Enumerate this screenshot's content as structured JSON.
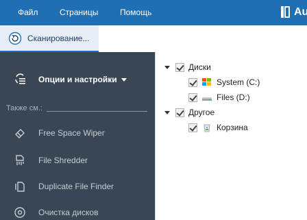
{
  "menubar": {
    "items": [
      "Файл",
      "Страницы",
      "Помощь"
    ],
    "brand_text": "Au",
    "background": "#1f6fb4"
  },
  "toolbar": {
    "scan_label": "Сканирование..."
  },
  "sidebar": {
    "options_label": "Опции и настройки",
    "also_label": "Также см.:",
    "tools": [
      {
        "label": "Free Space Wiper",
        "icon": "eraser-icon"
      },
      {
        "label": "File Shredder",
        "icon": "shredder-icon"
      },
      {
        "label": "Duplicate File Finder",
        "icon": "duplicate-icon"
      },
      {
        "label": "Очистка дисков",
        "icon": "disk-icon"
      }
    ]
  },
  "tree": {
    "disks_label": "Диски",
    "drives": [
      {
        "label": "System (C:)",
        "icon": "system-drive-icon",
        "checked": true
      },
      {
        "label": "Files (D:)",
        "icon": "drive-icon",
        "checked": true
      }
    ],
    "other_label": "Другое",
    "other_items": [
      {
        "label": "Корзина",
        "icon": "recycle-bin-icon",
        "checked": true
      }
    ]
  }
}
